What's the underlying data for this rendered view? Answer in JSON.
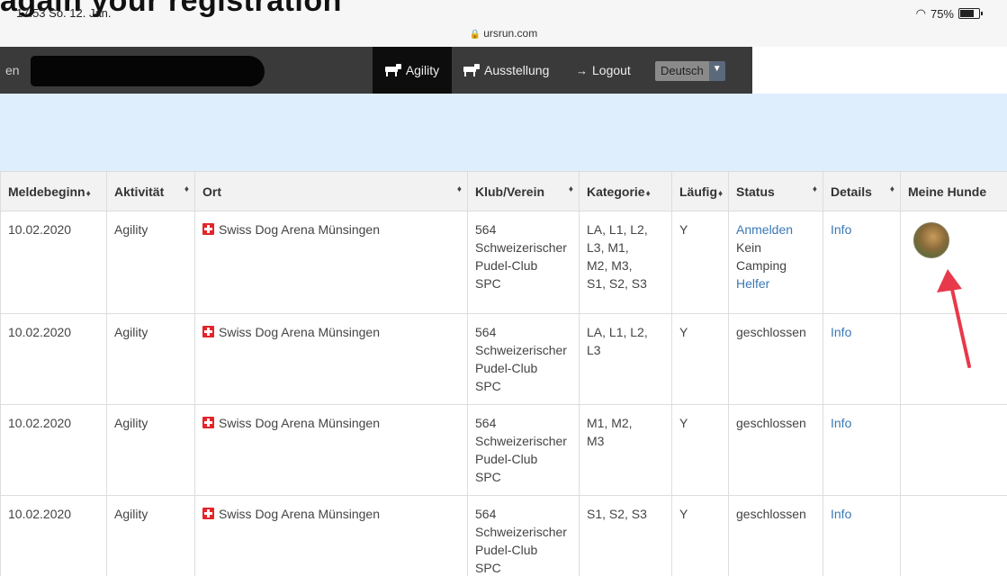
{
  "caption": "again your registration",
  "status_bar": {
    "time": "17:53  So. 12. Jan.",
    "battery": "75%"
  },
  "url_bar": {
    "domain": "ursrun.com"
  },
  "nav": {
    "left_fragment": "en",
    "items": [
      {
        "label": "Agility",
        "icon": "dog-icon",
        "active": true
      },
      {
        "label": "Ausstellung",
        "icon": "dog-icon",
        "active": false
      },
      {
        "label": "Logout",
        "icon": "logout-icon",
        "active": false
      }
    ],
    "language": "Deutsch"
  },
  "table": {
    "headers": [
      "Meldebeginn",
      "Aktivität",
      "Ort",
      "Klub/Verein",
      "Kategorie",
      "Läufig",
      "Status",
      "Details",
      "Meine Hunde"
    ],
    "rows": [
      {
        "meldebeginn": "10.02.2020",
        "aktivitaet": "Agility",
        "ort": "Swiss Dog Arena Münsingen",
        "klub": [
          "564",
          "Schweizerischer",
          "Pudel-Club",
          "SPC"
        ],
        "kategorie": [
          "LA, L1, L2,",
          "L3, M1,",
          "M2, M3,",
          "S1, S2, S3"
        ],
        "laeufig": "Y",
        "status": [
          {
            "text": "Anmelden",
            "link": true
          },
          {
            "text": "Kein",
            "link": false
          },
          {
            "text": "Camping",
            "link": false
          },
          {
            "text": "Helfer",
            "link": true
          }
        ],
        "details": "Info",
        "has_dog": true
      },
      {
        "meldebeginn": "10.02.2020",
        "aktivitaet": "Agility",
        "ort": "Swiss Dog Arena Münsingen",
        "klub": [
          "564",
          "Schweizerischer",
          "Pudel-Club",
          "SPC"
        ],
        "kategorie": [
          "LA, L1, L2,",
          "L3"
        ],
        "laeufig": "Y",
        "status": [
          {
            "text": "geschlossen",
            "link": false
          }
        ],
        "details": "Info",
        "has_dog": false
      },
      {
        "meldebeginn": "10.02.2020",
        "aktivitaet": "Agility",
        "ort": "Swiss Dog Arena Münsingen",
        "klub": [
          "564",
          "Schweizerischer",
          "Pudel-Club",
          "SPC"
        ],
        "kategorie": [
          "M1, M2,",
          "M3"
        ],
        "laeufig": "Y",
        "status": [
          {
            "text": "geschlossen",
            "link": false
          }
        ],
        "details": "Info",
        "has_dog": false
      },
      {
        "meldebeginn": "10.02.2020",
        "aktivitaet": "Agility",
        "ort": "Swiss Dog Arena Münsingen",
        "klub": [
          "564",
          "Schweizerischer",
          "Pudel-Club",
          "SPC"
        ],
        "kategorie": [
          "S1, S2, S3"
        ],
        "laeufig": "Y",
        "status": [
          {
            "text": "geschlossen",
            "link": false
          }
        ],
        "details": "Info",
        "has_dog": false
      }
    ]
  },
  "colors": {
    "nav_bg": "#3a3a3a",
    "nav_active": "#0d0d0d",
    "band": "#dfeefd",
    "link": "#3a78b5",
    "flag": "#e3242b",
    "arrow": "#e8394a"
  }
}
